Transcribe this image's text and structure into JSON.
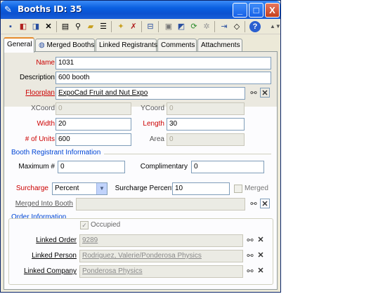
{
  "window": {
    "title": "Booths ID: 35",
    "app_icon": "booth-app-icon",
    "controls": {
      "minimize": "_",
      "maximize": "□",
      "close": "X"
    }
  },
  "toolbar": {
    "icons": [
      "save-icon",
      "save-close-icon",
      "save-new-icon",
      "delete-icon",
      "print-icon",
      "find-icon",
      "open-icon",
      "list-icon",
      "new-icon",
      "tools-icon",
      "copy-icon",
      "window-icon",
      "refresh-icon",
      "settings-icon",
      "import-icon",
      "note-icon",
      "help-icon"
    ]
  },
  "tabs": [
    {
      "label": "General",
      "active": true
    },
    {
      "label": "Merged Booths",
      "active": false
    },
    {
      "label": "Linked Registrants",
      "active": false
    },
    {
      "label": "Comments",
      "active": false
    },
    {
      "label": "Attachments",
      "active": false
    }
  ],
  "form": {
    "name_label": "Name",
    "name_value": "1031",
    "description_label": "Description",
    "description_value": "600 booth",
    "floorplan_label": "Floorplan",
    "floorplan_value": "ExpoCad Fruit and Nut Expo",
    "xcoord_label": "XCoord",
    "xcoord_value": "0",
    "ycoord_label": "YCoord",
    "ycoord_value": "0",
    "width_label": "Width",
    "width_value": "20",
    "length_label": "Length",
    "length_value": "30",
    "units_label": "# of Units",
    "units_value": "600",
    "area_label": "Area",
    "area_value": "0"
  },
  "registrant_info": {
    "title": "Booth Registrant Information",
    "maximum_label": "Maximum #",
    "maximum_value": "0",
    "complimentary_label": "Complimentary",
    "complimentary_value": "0"
  },
  "surcharge": {
    "label": "Surcharge",
    "selected": "Percent",
    "percent_label": "Surcharge Percent",
    "percent_value": "10",
    "merged_label": "Merged",
    "merged_checked": false,
    "merged_into_label": "Merged Into Booth",
    "merged_into_value": ""
  },
  "order_info": {
    "title": "Order Information",
    "occupied_label": "Occupied",
    "occupied_checked": true,
    "linked_order_label": "Linked Order",
    "linked_order_value": "9289",
    "linked_person_label": "Linked Person",
    "linked_person_value": "Rodriguez, Valerie/Ponderosa Physics",
    "linked_company_label": "Linked Company",
    "linked_company_value": "Ponderosa Physics"
  }
}
